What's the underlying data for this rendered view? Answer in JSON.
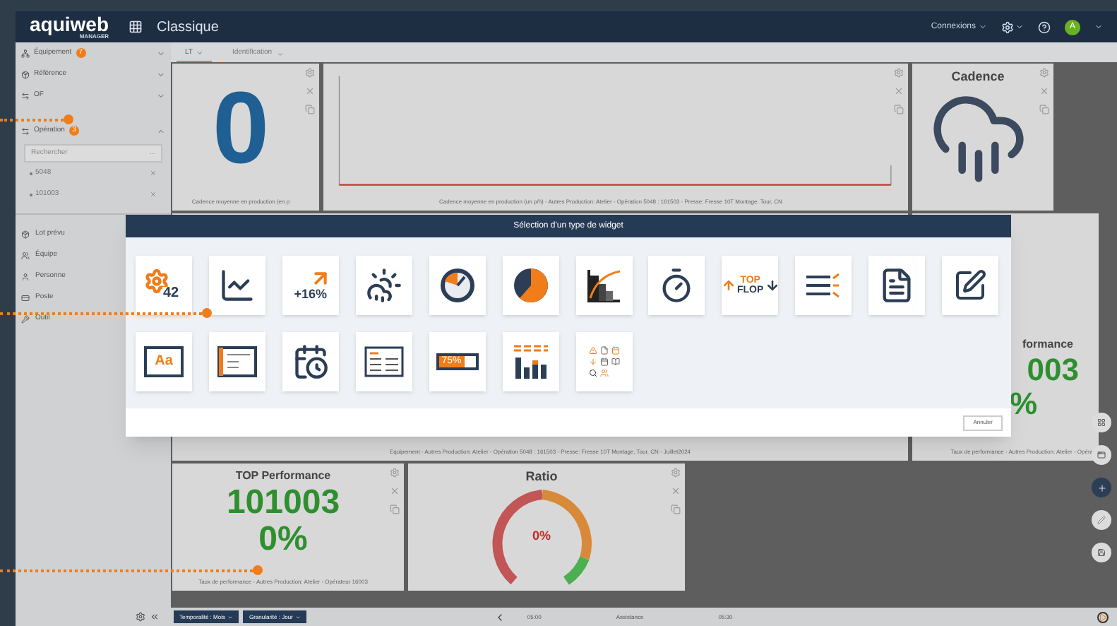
{
  "header": {
    "logo": "aquiweb",
    "logo_sub": "MANAGER",
    "view": "Classique",
    "menu": "Connexions",
    "avatar": "A"
  },
  "sidebar": {
    "filters": [
      {
        "label": "Équipement",
        "badge": "7",
        "expanded": false
      },
      {
        "label": "Référence",
        "expanded": false
      },
      {
        "label": "OF",
        "expanded": false
      },
      {
        "label": "Opération",
        "badge": "3",
        "expanded": true,
        "search": {
          "placeholder": "Rechercher",
          "button": "..."
        },
        "chips": [
          "5048",
          "101003"
        ]
      }
    ],
    "items": [
      "Lot prévu",
      "Équipe",
      "Personne",
      "Poste",
      "Outil"
    ]
  },
  "tabs": [
    {
      "label": "LT",
      "selected": true
    },
    {
      "label": "Identification",
      "selected": false
    }
  ],
  "widgets": {
    "counter": {
      "value": "0",
      "caption": "Cadence moyenne en production (en p"
    },
    "chart": {
      "legend": "Cadence moyenne en production (un p/h) - Autres Production: Atelier - Opération 5048 : 161503 - Presse: Fresse 10T Montage, Tour, CN"
    },
    "weather": {
      "title": "Cadence"
    },
    "hidden_caption": "Equipement - Autres Production: Atelier - Opération 5048 : 161503 - Presse: Fresse 10T Montage, Tour, CN - Juillet2024",
    "partial": {
      "title": "formance",
      "value": "003",
      "percent": "%",
      "caption": "Taux de performance - Autres Production: Atelier - Opéra"
    },
    "top": {
      "title": "TOP Performance",
      "value": "101003",
      "percent": "0%",
      "caption": "Taux de performance - Autres Production: Atelier - Opérateur 16003"
    },
    "ratio": {
      "title": "Ratio",
      "value": "0%"
    }
  },
  "dialog": {
    "title": "Sélection d'un type de widget",
    "cancel": "Annuler",
    "tiles": [
      {
        "kind": "counter",
        "text": "42"
      },
      {
        "kind": "line"
      },
      {
        "kind": "trend",
        "text": "+16%"
      },
      {
        "kind": "weather"
      },
      {
        "kind": "gauge"
      },
      {
        "kind": "pie"
      },
      {
        "kind": "pareto"
      },
      {
        "kind": "stopwatch"
      },
      {
        "kind": "topflop",
        "text": "TOP",
        "text2": "FLOP"
      },
      {
        "kind": "list"
      },
      {
        "kind": "document"
      },
      {
        "kind": "edit"
      },
      {
        "kind": "monitor",
        "text": "Aa"
      },
      {
        "kind": "card"
      },
      {
        "kind": "calendar"
      },
      {
        "kind": "table"
      },
      {
        "kind": "battery",
        "text": "75%"
      },
      {
        "kind": "bars"
      },
      {
        "kind": "misc"
      }
    ]
  },
  "bottom": {
    "filters": [
      "Temporalité : Mois",
      "Granularité : Jour"
    ],
    "time_start": "05:00",
    "label": "Assistance",
    "time_end": "05:30"
  }
}
